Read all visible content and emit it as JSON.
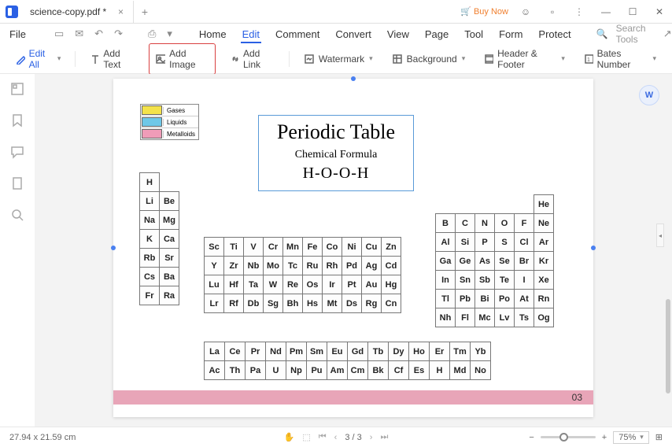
{
  "titlebar": {
    "tab_name": "science-copy.pdf *",
    "buy_now": "Buy Now"
  },
  "menubar": {
    "file": "File",
    "items": [
      "Home",
      "Edit",
      "Comment",
      "Convert",
      "View",
      "Page",
      "Tool",
      "Form",
      "Protect"
    ],
    "search_placeholder": "Search Tools"
  },
  "toolbar": {
    "edit_all": "Edit All",
    "add_text": "Add Text",
    "add_image": "Add Image",
    "add_link": "Add Link",
    "watermark": "Watermark",
    "background": "Background",
    "header_footer": "Header & Footer",
    "bates_number": "Bates Number"
  },
  "document": {
    "legend": [
      {
        "color": "c-yellow",
        "label": "Gases"
      },
      {
        "color": "c-cyan",
        "label": "Liquids"
      },
      {
        "color": "c-pink",
        "label": "Metalloids"
      }
    ],
    "title": "Periodic Table",
    "subtitle": "Chemical Formula",
    "formula": "H-O-O-H",
    "page_number": "03",
    "elements": {
      "left": [
        [
          "H"
        ],
        [
          "Li",
          "Be"
        ],
        [
          "Na",
          "Mg"
        ],
        [
          "K",
          "Ca"
        ],
        [
          "Rb",
          "Sr"
        ],
        [
          "Cs",
          "Ba"
        ],
        [
          "Fr",
          "Ra"
        ]
      ],
      "mid": [
        [
          "Sc",
          "Ti",
          "V",
          "Cr",
          "Mn",
          "Fe",
          "Co",
          "Ni",
          "Cu",
          "Zn"
        ],
        [
          "Y",
          "Zr",
          "Nb",
          "Mo",
          "Tc",
          "Ru",
          "Rh",
          "Pd",
          "Ag",
          "Cd"
        ],
        [
          "Lu",
          "Hf",
          "Ta",
          "W",
          "Re",
          "Os",
          "Ir",
          "Pt",
          "Au",
          "Hg"
        ],
        [
          "Lr",
          "Rf",
          "Db",
          "Sg",
          "Bh",
          "Hs",
          "Mt",
          "Ds",
          "Rg",
          "Cn"
        ]
      ],
      "right": [
        [
          "",
          "",
          "",
          "",
          "",
          "He"
        ],
        [
          "B",
          "C",
          "N",
          "O",
          "F",
          "Ne"
        ],
        [
          "Al",
          "Si",
          "P",
          "S",
          "Cl",
          "Ar"
        ],
        [
          "Ga",
          "Ge",
          "As",
          "Se",
          "Br",
          "Kr"
        ],
        [
          "In",
          "Sn",
          "Sb",
          "Te",
          "I",
          "Xe"
        ],
        [
          "Tl",
          "Pb",
          "Bi",
          "Po",
          "At",
          "Rn"
        ],
        [
          "Nh",
          "Fl",
          "Mc",
          "Lv",
          "Ts",
          "Og"
        ]
      ],
      "lan": [
        [
          "La",
          "Ce",
          "Pr",
          "Nd",
          "Pm",
          "Sm",
          "Eu",
          "Gd",
          "Tb",
          "Dy",
          "Ho",
          "Er",
          "Tm",
          "Yb"
        ],
        [
          "Ac",
          "Th",
          "Pa",
          "U",
          "Np",
          "Pu",
          "Am",
          "Cm",
          "Bk",
          "Cf",
          "Es",
          "H",
          "Md",
          "No"
        ]
      ]
    },
    "colored": {
      "yellow": [
        "H",
        "He",
        "N",
        "O",
        "F",
        "Ne",
        "Cl",
        "Ar",
        "Kr",
        "Xe",
        "Rn",
        "At",
        "Og"
      ],
      "cyan": [
        "Hg",
        "Br"
      ],
      "pink": [
        "B",
        "Si",
        "Ge",
        "As",
        "Sb",
        "Te"
      ]
    }
  },
  "statusbar": {
    "dimensions": "27.94 x 21.59 cm",
    "page_current": "3",
    "page_total": "/ 3",
    "zoom": "75%"
  }
}
